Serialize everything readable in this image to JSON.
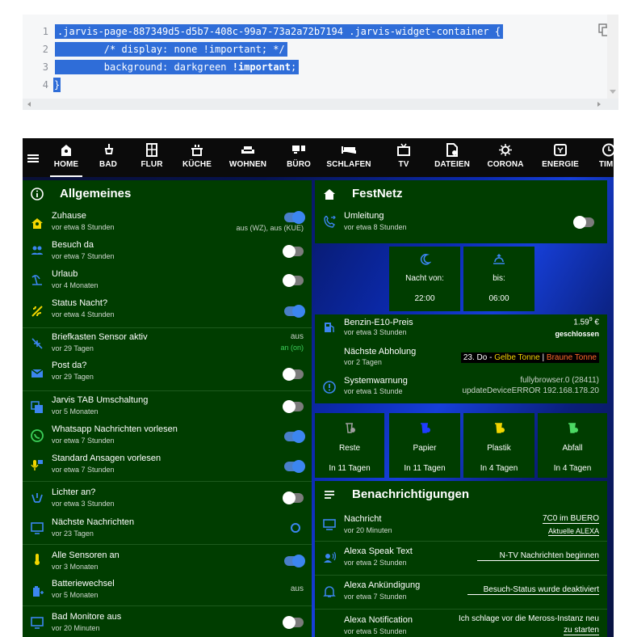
{
  "editor": {
    "lines": [
      {
        "num": "1",
        "text": ".jarvis-page-887349d5-d5b7-408c-99a7-73a2a72b7194 .jarvis-widget-container {"
      },
      {
        "num": "2",
        "text": "        /* display: none !important; */"
      },
      {
        "num": "3a",
        "text": "        background: darkgreen "
      },
      {
        "num": "3b",
        "text": "!important"
      },
      {
        "num": "3c",
        "text": ";"
      },
      {
        "num": "4",
        "text": "}"
      }
    ],
    "numbers": [
      "1",
      "2",
      "3",
      "4"
    ],
    "copy_icon": "copy-icon"
  },
  "nav": {
    "tabs": [
      {
        "label": "HOME",
        "icon": "home-icon"
      },
      {
        "label": "BAD",
        "icon": "shower-icon"
      },
      {
        "label": "FLUR",
        "icon": "door-icon"
      },
      {
        "label": "KÜCHE",
        "icon": "pot-icon"
      },
      {
        "label": "WOHNEN",
        "icon": "sofa-icon"
      },
      {
        "label": "BÜRO",
        "icon": "desk-icon"
      },
      {
        "label": "SCHLAFEN",
        "icon": "bed-icon"
      },
      {
        "label": "TV",
        "icon": "tv-icon"
      },
      {
        "label": "DATEIEN",
        "icon": "file-icon"
      },
      {
        "label": "CORONA",
        "icon": "virus-icon"
      },
      {
        "label": "ENERGIE",
        "icon": "energy-icon"
      },
      {
        "label": "TIME",
        "icon": "clock-icon"
      }
    ]
  },
  "allgemeines": {
    "title": "Allgemeines",
    "rows": [
      {
        "title": "Zuhause",
        "sub": "vor etwa 8 Stunden",
        "value": "aus (WZ), aus (KUE)",
        "state": "on",
        "icon_color": "#f2d600"
      },
      {
        "title": "Besuch da",
        "sub": "vor etwa 7 Stunden",
        "state": "off"
      },
      {
        "title": "Urlaub",
        "sub": "vor 4 Monaten",
        "state": "off"
      },
      {
        "title": "Status Nacht?",
        "sub": "vor etwa 4 Stunden",
        "state": "on",
        "icon_color": "#f2d600"
      },
      {
        "title": "Briefkasten Sensor aktiv",
        "sub": "vor 29 Tagen",
        "value": "aus",
        "value2": "an (on)"
      },
      {
        "title": "Post da?",
        "sub": "vor 29 Tagen",
        "state": "off"
      },
      {
        "title": "Jarvis TAB Umschaltung",
        "sub": "vor 5 Monaten",
        "state": "off"
      },
      {
        "title": "Whatsapp Nachrichten vorlesen",
        "sub": "vor etwa 7 Stunden",
        "state": "on"
      },
      {
        "title": "Standard Ansagen vorlesen",
        "sub": "vor etwa 7 Stunden",
        "state": "on"
      },
      {
        "title": "Lichter an?",
        "sub": "vor etwa 3 Stunden",
        "state": "off"
      },
      {
        "title": "Nächste Nachrichten",
        "sub": "vor 23 Tagen",
        "state": "radio"
      },
      {
        "title": "Alle Sensoren an",
        "sub": "vor 3 Monaten",
        "state": "on"
      },
      {
        "title": "Batteriewechsel",
        "sub": "vor 5 Monaten",
        "value": "aus"
      },
      {
        "title": "Bad Monitore aus",
        "sub": "vor 20 Minuten",
        "state": "off"
      }
    ]
  },
  "festnetz": {
    "title": "FestNetz",
    "row": {
      "title": "Umleitung",
      "sub": "vor etwa 8 Stunden",
      "state": "off"
    }
  },
  "nacht": {
    "label_from": "Nacht von:",
    "label_to": "bis:",
    "time_from": "22:00",
    "time_to": "06:00"
  },
  "info": {
    "benzin": {
      "title": "Benzin-E10-Preis",
      "sub": "vor etwa 3 Stunden",
      "price": "1.59",
      "sup": "9",
      "currency": " €",
      "status": "geschlossen"
    },
    "abholung": {
      "title": "Nächste Abholung",
      "sub": "vor 2 Tagen",
      "prefix": "23. Do - ",
      "gelbe": "Gelbe Tonne",
      "sep": " | ",
      "braune": "Braune Tonne",
      "gelbe_color": "#f2d600",
      "braune_color": "#ff6a2a"
    },
    "warnung": {
      "title": "Systemwarnung",
      "sub": "vor etwa 1 Stunde",
      "line1": "fullybrowser.0 (28411)",
      "line2": "updateDeviceERROR 192.168.178.20"
    }
  },
  "muell": [
    {
      "label": "Reste",
      "when": "In 11 Tagen",
      "color": "#9e9e9e"
    },
    {
      "label": "Papier",
      "when": "In 11 Tagen",
      "color": "#1f3cff"
    },
    {
      "label": "Plastik",
      "when": "In 4 Tagen",
      "color": "#f2d600"
    },
    {
      "label": "Abfall",
      "when": "In 4 Tagen",
      "color": "#4cd964"
    }
  ],
  "benachrichtigungen": {
    "title": "Benachrichtigungen",
    "rows": [
      {
        "title": "Nachricht",
        "sub": "vor 20 Minuten",
        "v1": "7C0 im BUERO",
        "v2": "Aktuelle ALEXA"
      },
      {
        "title": "Alexa Speak Text",
        "sub": "vor etwa 2 Stunden",
        "v1": "N-TV Nachrichten beginnen"
      },
      {
        "title": "Alexa Ankündigung",
        "sub": "vor etwa 7 Stunden",
        "v1": "Besuch-Status wurde deaktiviert"
      },
      {
        "title": "Alexa Notification",
        "sub": "vor etwa 5 Stunden",
        "v1": "Ich schlage vor die Meross-Instanz neu",
        "v2": "zu starten"
      }
    ]
  }
}
